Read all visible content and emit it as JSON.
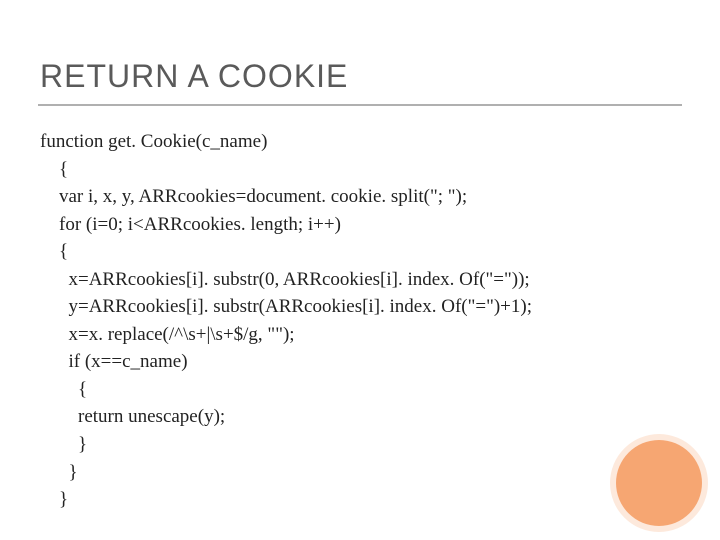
{
  "title": "RETURN A COOKIE",
  "code": {
    "l0": "function get. Cookie(c_name)",
    "l1": "    {",
    "l2": "    var i, x, y, ARRcookies=document. cookie. split(\"; \");",
    "l3": "    for (i=0; i<ARRcookies. length; i++)",
    "l4": "    {",
    "l5": "      x=ARRcookies[i]. substr(0, ARRcookies[i]. index. Of(\"=\"));",
    "l6": "      y=ARRcookies[i]. substr(ARRcookies[i]. index. Of(\"=\")+1);",
    "l7": "      x=x. replace(/^\\s+|\\s+$/g, \"\");",
    "l8": "      if (x==c_name)",
    "l9": "        {",
    "l10": "        return unescape(y);",
    "l11": "        }",
    "l12": "      }",
    "l13": "    }"
  }
}
